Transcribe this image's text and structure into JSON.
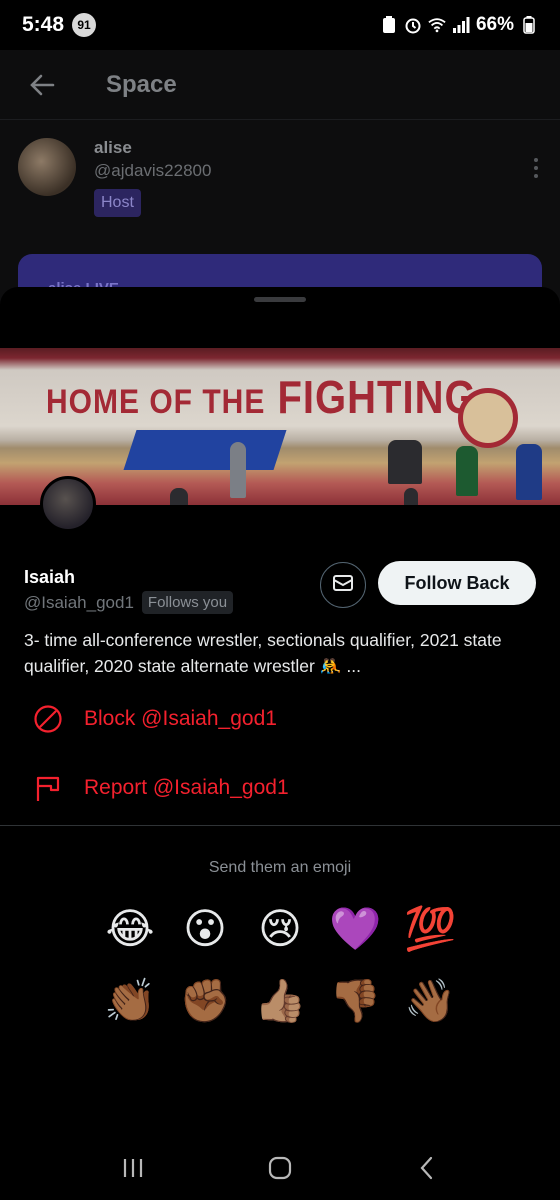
{
  "status_bar": {
    "time": "5:48",
    "notification_count": "91",
    "battery": "66%"
  },
  "background_page": {
    "title": "Space",
    "host": {
      "name": "alise",
      "handle": "@ajdavis22800",
      "badge": "Host"
    },
    "live_card_text": "alise LIVE"
  },
  "profile": {
    "name": "Isaiah",
    "handle": "@Isaiah_god1",
    "follows_you": "Follows you",
    "follow_button": "Follow Back",
    "bio": "3- time all-conference wrestler, sectionals qualifier, 2021 state qualifier, 2020 state alternate wrestler 🤼 ...",
    "banner_text_a": "HOME OF THE",
    "banner_text_b": "FIGHTING"
  },
  "actions": {
    "block": "Block @Isaiah_god1",
    "report": "Report @Isaiah_god1"
  },
  "emoji_section": {
    "prompt": "Send them an emoji",
    "row1": [
      "😂",
      "😮",
      "😢",
      "💜",
      "💯"
    ],
    "row2": [
      "👏🏾",
      "✊🏾",
      "👍🏽",
      "👎🏾",
      "👋🏾"
    ]
  },
  "colors": {
    "danger": "#f4212e",
    "host_badge_bg": "#2c2560",
    "follow_button_bg": "#eff3f4"
  },
  "icons": {
    "back": "back-arrow-icon",
    "message": "envelope-icon",
    "block": "block-icon",
    "report": "flag-icon",
    "nav": [
      "recents-icon",
      "home-icon",
      "back-icon"
    ]
  }
}
